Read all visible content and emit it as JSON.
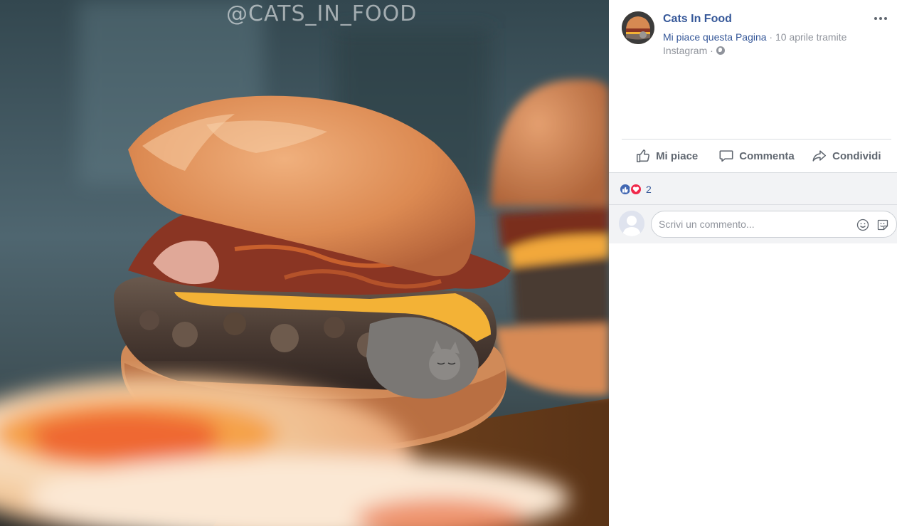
{
  "photo": {
    "watermark": "@CATS_IN_FOOD"
  },
  "post": {
    "page_name": "Cats In Food",
    "like_page": "Mi piace questa Pagina",
    "meta_sep1": " · ",
    "date_via": "10 aprile tramite",
    "source": "Instagram",
    "meta_sep2": " · ",
    "privacy_icon": "globe-icon",
    "more_icon": "ellipsis-icon"
  },
  "actions": {
    "like": "Mi piace",
    "comment": "Commenta",
    "share": "Condividi"
  },
  "reactions": {
    "types": [
      "like",
      "love"
    ],
    "count": "2"
  },
  "comment_input": {
    "placeholder": "Scrivi un commento..."
  },
  "colors": {
    "link": "#365899",
    "secondary_text": "#90949c",
    "action_text": "#606770",
    "like_reaction": "#4267b2",
    "love_reaction": "#f0284a",
    "panel_grey": "#f2f3f5"
  }
}
